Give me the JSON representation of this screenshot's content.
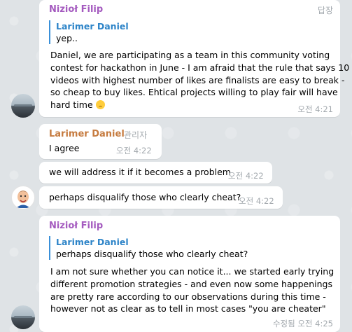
{
  "messages": [
    {
      "sender": "Nizioł Filip",
      "sender_color": "#a45abf",
      "reply_tag": "답장",
      "quote": {
        "name": "Larimer Daniel",
        "text": "yep.."
      },
      "lines": [
        "Daniel, we are participating as a team in this community voting",
        "contest for hackathon in June - I am afraid that the rule that says 10",
        "videos with highest number of likes are finalists are easy to break -",
        "so cheap to buy likes. Ehtical projects willing to play fair will have",
        "hard time"
      ],
      "emoji": "confused-face",
      "time": "오전 4:21"
    },
    {
      "sender": "Larimer Daniel",
      "sender_color": "#c67b3f",
      "role": "관리자",
      "text": "I agree",
      "time": "오전 4:22"
    },
    {
      "text": "we will address it if it becomes a problem",
      "time": "오전 4:22"
    },
    {
      "text": "perhaps disqualify those who clearly cheat?",
      "time": "오전 4:22"
    },
    {
      "sender": "Nizioł Filip",
      "sender_color": "#a45abf",
      "quote": {
        "name": "Larimer Daniel",
        "text": "perhaps disqualify those who clearly cheat?"
      },
      "lines": [
        "I am not sure whether you can notice it... we started early trying",
        "different promotion strategies - and even now some happenings",
        "are pretty rare according to our observations during this time -",
        "however not as clear as to tell in most cases \"you are cheater\""
      ],
      "time": "수정됨 오전 4:25"
    }
  ]
}
